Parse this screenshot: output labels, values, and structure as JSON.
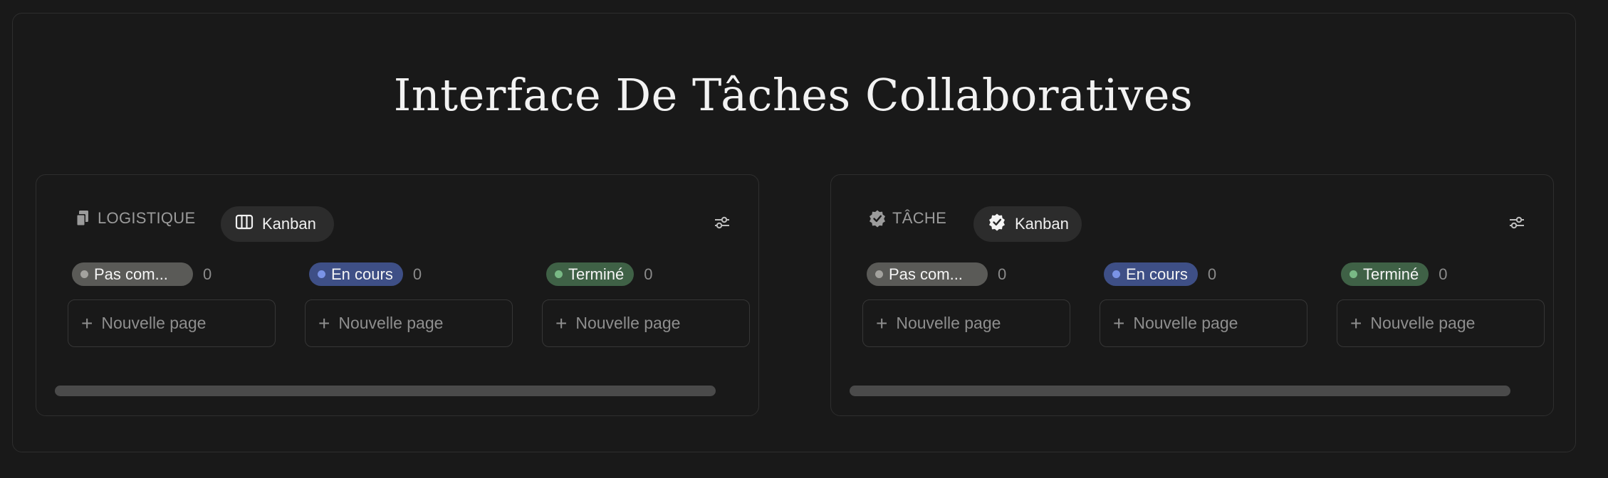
{
  "page": {
    "title": "Interface De Tâches Collaboratives"
  },
  "boards": [
    {
      "database_name": "LOGISTIQUE",
      "database_icon": "documents-icon",
      "view_tab": {
        "label": "Kanban",
        "icon": "board-columns-icon"
      },
      "filter_icon": "sliders-icon",
      "columns": [
        {
          "status": "Pas com...",
          "color": "#5a5a57",
          "count": "0",
          "new_page_label": "Nouvelle page"
        },
        {
          "status": "En cours",
          "color": "#3e4f86",
          "count": "0",
          "new_page_label": "Nouvelle page"
        },
        {
          "status": "Terminé",
          "color": "#3f6146",
          "count": "0",
          "new_page_label": "Nouvelle page"
        }
      ]
    },
    {
      "database_name": "TÂCHE",
      "database_icon": "check-badge-icon",
      "view_tab": {
        "label": "Kanban",
        "icon": "check-badge-icon"
      },
      "filter_icon": "sliders-icon",
      "columns": [
        {
          "status": "Pas com...",
          "color": "#5a5a57",
          "count": "0",
          "new_page_label": "Nouvelle page"
        },
        {
          "status": "En cours",
          "color": "#3e4f86",
          "count": "0",
          "new_page_label": "Nouvelle page"
        },
        {
          "status": "Terminé",
          "color": "#3f6146",
          "count": "0",
          "new_page_label": "Nouvelle page"
        }
      ]
    }
  ]
}
